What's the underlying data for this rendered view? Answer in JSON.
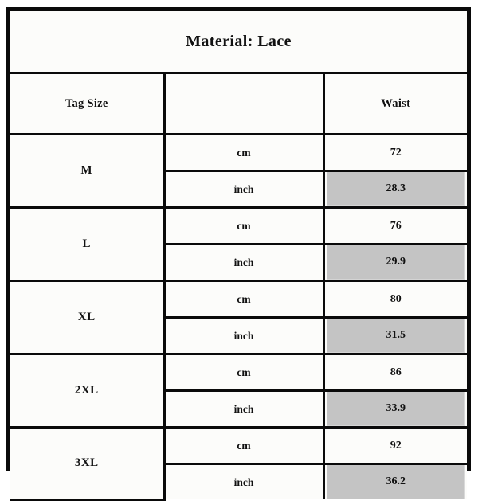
{
  "chart": {
    "title": "Material:  Lace",
    "columns": {
      "size_label": "Tag Size",
      "unit_label": "",
      "measure_label": "Waist"
    },
    "units": {
      "metric": "cm",
      "imperial": "inch"
    },
    "colors": {
      "border": "#0a0a0a",
      "background": "#fcfcfa",
      "shaded_cell": "#c4c4c4",
      "text": "#111111"
    },
    "rows": [
      {
        "size": "M",
        "waist_cm": "72",
        "waist_inch": "28.3"
      },
      {
        "size": "L",
        "waist_cm": "76",
        "waist_inch": "29.9"
      },
      {
        "size": "XL",
        "waist_cm": "80",
        "waist_inch": "31.5"
      },
      {
        "size": "2XL",
        "waist_cm": "86",
        "waist_inch": "33.9"
      },
      {
        "size": "3XL",
        "waist_cm": "92",
        "waist_inch": "36.2"
      }
    ]
  },
  "chart_data": {
    "type": "table",
    "title": "Material:  Lace",
    "columns": [
      "Tag Size",
      "",
      "Waist"
    ],
    "categories": [
      "M",
      "L",
      "XL",
      "2XL",
      "3XL"
    ],
    "series": [
      {
        "name": "cm",
        "values": [
          72,
          76,
          80,
          86,
          92
        ]
      },
      {
        "name": "inch",
        "values": [
          28.3,
          29.9,
          31.5,
          33.9,
          36.2
        ]
      }
    ],
    "xlabel": "Tag Size",
    "ylabel": "Waist",
    "grid": true,
    "legend": "none"
  }
}
